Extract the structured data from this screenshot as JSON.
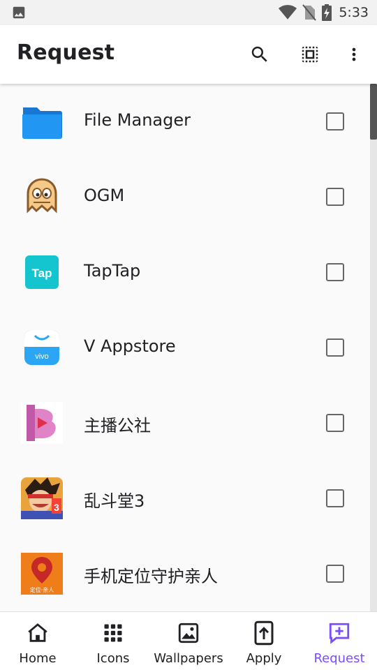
{
  "status_bar": {
    "time": "5:33"
  },
  "app_bar": {
    "title": "Request"
  },
  "apps": [
    {
      "name": "File Manager",
      "checked": false
    },
    {
      "name": "OGM",
      "checked": false
    },
    {
      "name": "TapTap",
      "checked": false,
      "icon_text": "Tap"
    },
    {
      "name": "V Appstore",
      "checked": false,
      "icon_text": "vivo"
    },
    {
      "name": "主播公社",
      "checked": false
    },
    {
      "name": "乱斗堂3",
      "checked": false
    },
    {
      "name": "手机定位守护亲人",
      "checked": false,
      "icon_text": "定位·亲人"
    }
  ],
  "bottom_nav": [
    {
      "label": "Home",
      "icon": "home-icon"
    },
    {
      "label": "Icons",
      "icon": "grid-icon"
    },
    {
      "label": "Wallpapers",
      "icon": "image-icon"
    },
    {
      "label": "Apply",
      "icon": "apply-icon"
    },
    {
      "label": "Request",
      "icon": "request-icon",
      "active": true
    }
  ],
  "colors": {
    "accent": "#7c4dff",
    "appbar": "#ffffff",
    "background": "#fafafa"
  }
}
